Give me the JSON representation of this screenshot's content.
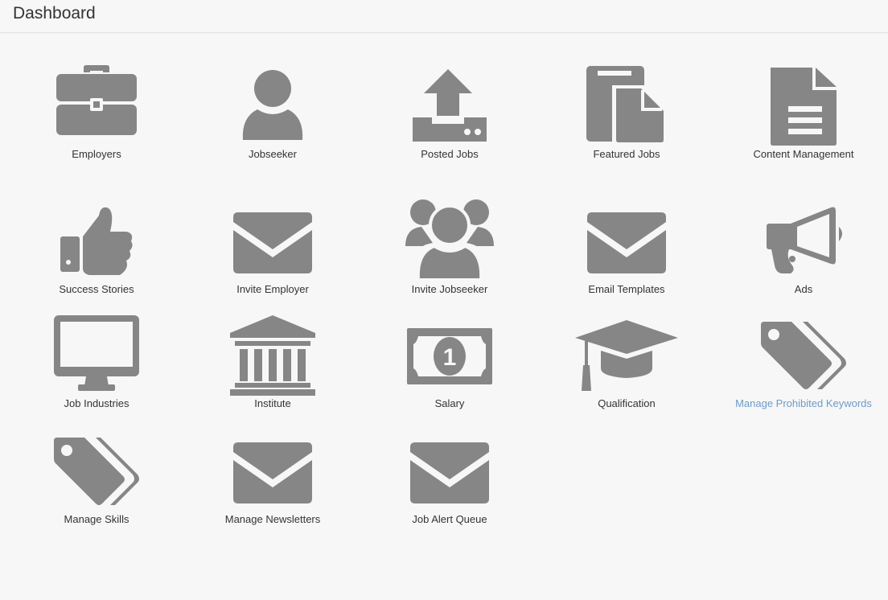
{
  "header": {
    "title": "Dashboard"
  },
  "icon_color": "#868686",
  "link_color": "#6e9bc8",
  "tiles": [
    {
      "label": "Employers",
      "icon": "briefcase-icon"
    },
    {
      "label": "Jobseeker",
      "icon": "user-icon"
    },
    {
      "label": "Posted Jobs",
      "icon": "upload-icon"
    },
    {
      "label": "Featured Jobs",
      "icon": "files-icon"
    },
    {
      "label": "Content Management",
      "icon": "document-icon"
    },
    {
      "label": "Success Stories",
      "icon": "thumbs-up-icon"
    },
    {
      "label": "Invite Employer",
      "icon": "envelope-icon"
    },
    {
      "label": "Invite Jobseeker",
      "icon": "users-icon"
    },
    {
      "label": "Email Templates",
      "icon": "envelope-icon"
    },
    {
      "label": "Ads",
      "icon": "bullhorn-icon"
    },
    {
      "label": "Job Industries",
      "icon": "monitor-icon"
    },
    {
      "label": "Institute",
      "icon": "institution-icon"
    },
    {
      "label": "Salary",
      "icon": "banknote-icon"
    },
    {
      "label": "Qualification",
      "icon": "graduation-cap-icon"
    },
    {
      "label": "Manage Prohibited Keywords",
      "icon": "tags-icon"
    },
    {
      "label": "Manage Skills",
      "icon": "tags-icon"
    },
    {
      "label": "Manage Newsletters",
      "icon": "envelope-icon"
    },
    {
      "label": "Job Alert Queue",
      "icon": "envelope-icon"
    }
  ]
}
